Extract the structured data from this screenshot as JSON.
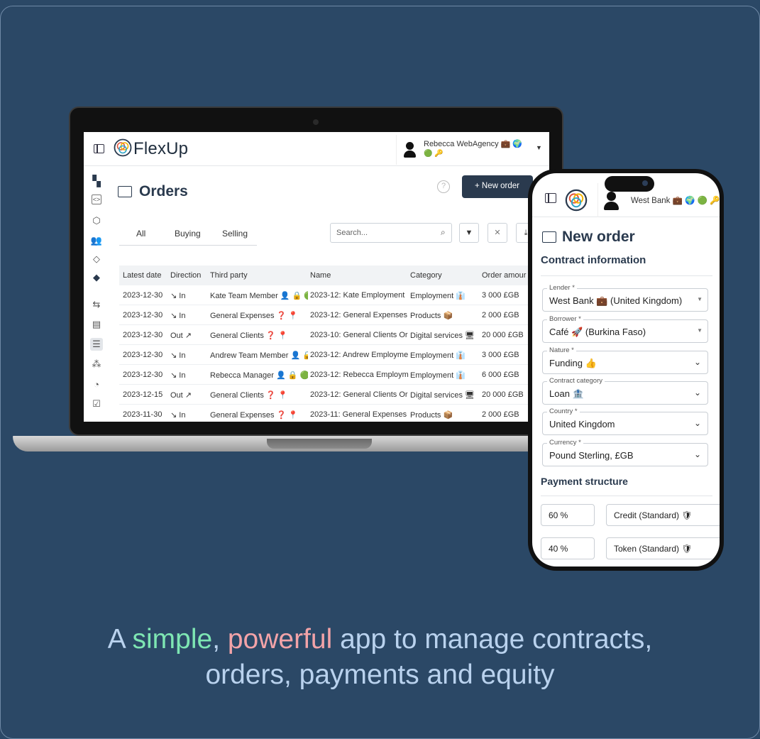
{
  "colors": {
    "background": "#2b4866",
    "primary": "#2a3a4e",
    "accent_green": "#7ee6b3",
    "accent_pink": "#f3a3a8",
    "tagline_text": "#b9d2ee"
  },
  "laptop": {
    "brand": "FlexUp",
    "user": {
      "name": "Rebecca WebAgency",
      "badges_line1": "💼 🌍",
      "badges_line2": "🟢 🔑"
    },
    "sidebar_icons": [
      "dashboard-icon",
      "code-icon",
      "box-icon",
      "users-icon",
      "tag-icon",
      "tag-filled-icon",
      "swap-icon",
      "document-icon",
      "orders-icon",
      "network-icon",
      "chart-icon",
      "check-icon"
    ],
    "page": {
      "title": "Orders",
      "help": "?",
      "new_order_label": "+ New order"
    },
    "tabs": [
      "All",
      "Buying",
      "Selling"
    ],
    "search": {
      "placeholder": "Search..."
    },
    "table": {
      "columns": [
        "Latest date",
        "Direction",
        "Third party",
        "Name",
        "Category",
        "Order amour"
      ],
      "rows": [
        [
          "2023-12-30",
          "↘ In",
          "Kate Team Member 👤 🔒 🟢",
          "2023-12: Kate Employment",
          "Employment 👔",
          "3 000 £GB"
        ],
        [
          "2023-12-30",
          "↘ In",
          "General Expenses ❓ 📍",
          "2023-12: General Expenses",
          "Products 📦",
          "2 000 £GB"
        ],
        [
          "2023-12-30",
          "Out ↗",
          "General Clients ❓ 📍",
          "2023-10: General Clients Or",
          "Digital services 🖥",
          "20 000 £GB"
        ],
        [
          "2023-12-30",
          "↘ In",
          "Andrew Team Member 👤 🔒",
          "2023-12: Andrew Employme",
          "Employment 👔",
          "3 000 £GB"
        ],
        [
          "2023-12-30",
          "↘ In",
          "Rebecca Manager 👤 🔒 🟢",
          "2023-12: Rebecca Employm",
          "Employment 👔",
          "6 000 £GB"
        ],
        [
          "2023-12-15",
          "Out ↗",
          "General Clients ❓ 📍",
          "2023-12: General Clients Or",
          "Digital services 🖥",
          "20 000 £GB"
        ],
        [
          "2023-11-30",
          "↘ In",
          "General Expenses ❓ 📍",
          "2023-11: General Expenses",
          "Products 📦",
          "2 000 £GB"
        ]
      ]
    }
  },
  "phone": {
    "user": {
      "name": "West Bank",
      "badges": "💼 🌍 🟢 🔑"
    },
    "title": "New order",
    "contract_section": "Contract information",
    "fields": [
      {
        "label": "Lender *",
        "value": "West Bank 💼 (United Kingdom)",
        "control": "select"
      },
      {
        "label": "Borrower *",
        "value": "Café 🚀 (Burkina Faso)",
        "control": "select"
      },
      {
        "label": "Nature *",
        "value": "Funding 👍",
        "control": "chevron"
      },
      {
        "label": "Contract category",
        "value": "Loan 🏦",
        "control": "chevron"
      },
      {
        "label": "Country *",
        "value": "United Kingdom",
        "control": "chevron"
      },
      {
        "label": "Currency *",
        "value": "Pound Sterling, £GB",
        "control": "chevron"
      }
    ],
    "payment_section": "Payment structure",
    "payments": [
      {
        "percent": "60 %",
        "type": "Credit (Standard) 🛡"
      },
      {
        "percent": "40 %",
        "type": "Token (Standard) 🛡"
      }
    ]
  },
  "tagline": {
    "prefix": "A ",
    "word1": "simple",
    "sep": ", ",
    "word2": "powerful",
    "line1_rest": " app to manage contracts,",
    "line2": "orders, payments and equity"
  }
}
